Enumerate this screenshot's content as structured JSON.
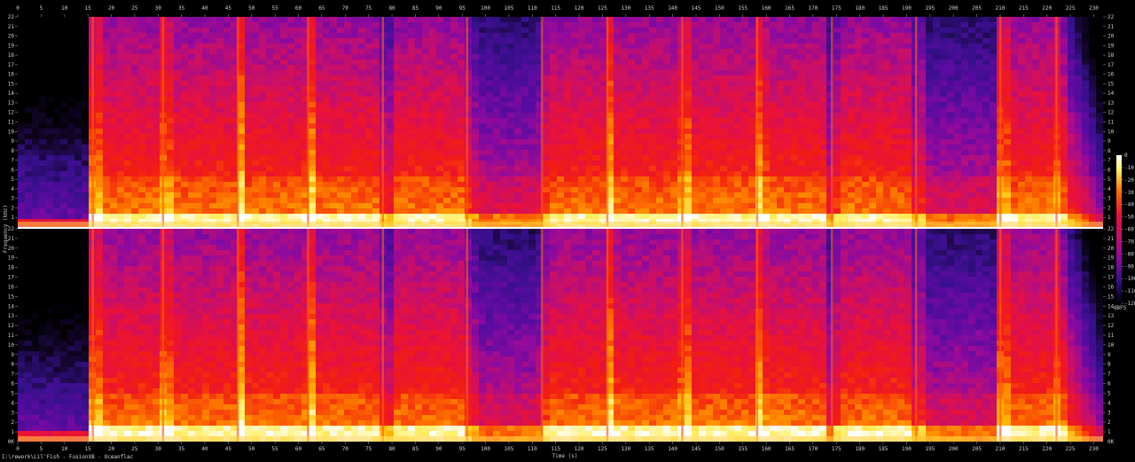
{
  "file_path": "I:\\rework\\Lil'Fish - FusionXB - Oceanflac",
  "chart_data": {
    "type": "heatmap",
    "title": "",
    "xlabel": "Time (s)",
    "ylabel": "Frequency (kHz)",
    "xlim": [
      0,
      232
    ],
    "ylim": [
      0,
      22
    ],
    "x_ticks": [
      0,
      5,
      10,
      15,
      20,
      25,
      30,
      35,
      40,
      45,
      50,
      55,
      60,
      65,
      70,
      75,
      80,
      85,
      90,
      95,
      100,
      105,
      110,
      115,
      120,
      125,
      130,
      135,
      140,
      145,
      150,
      155,
      160,
      165,
      170,
      175,
      180,
      185,
      190,
      195,
      200,
      205,
      210,
      215,
      220,
      225,
      230
    ],
    "y_ticks": [
      "1",
      "2",
      "3",
      "4",
      "5",
      "6",
      "7",
      "8",
      "9",
      "10",
      "11",
      "12",
      "13",
      "14",
      "15",
      "16",
      "17",
      "18",
      "19",
      "20",
      "21",
      "22"
    ],
    "y_zero_label": "0K",
    "channels": [
      "top",
      "bottom"
    ],
    "colorbar": {
      "label": "dBFS",
      "ticks": [
        "0",
        "-10",
        "-20",
        "-30",
        "-40",
        "-50",
        "-60",
        "-70",
        "-80",
        "-90",
        "-100",
        "-110",
        "-120"
      ],
      "range": [
        -120,
        0
      ]
    },
    "colormap": [
      "#000000",
      "#14062e",
      "#35108a",
      "#5a0ba0",
      "#8e0a9e",
      "#c40f6e",
      "#e8113c",
      "#f21e12",
      "#fc6a00",
      "#ffb400",
      "#ffee60",
      "#ffffff"
    ],
    "quiet_regions_s": [
      [
        0,
        15
      ],
      [
        77,
        80
      ],
      [
        95,
        113
      ],
      [
        172,
        175
      ],
      [
        190,
        208
      ]
    ],
    "transients_s": [
      16,
      31,
      47,
      62,
      78,
      96,
      112,
      126,
      142,
      158,
      174,
      192,
      210,
      222
    ],
    "fade_out_s": [
      220,
      232
    ]
  }
}
